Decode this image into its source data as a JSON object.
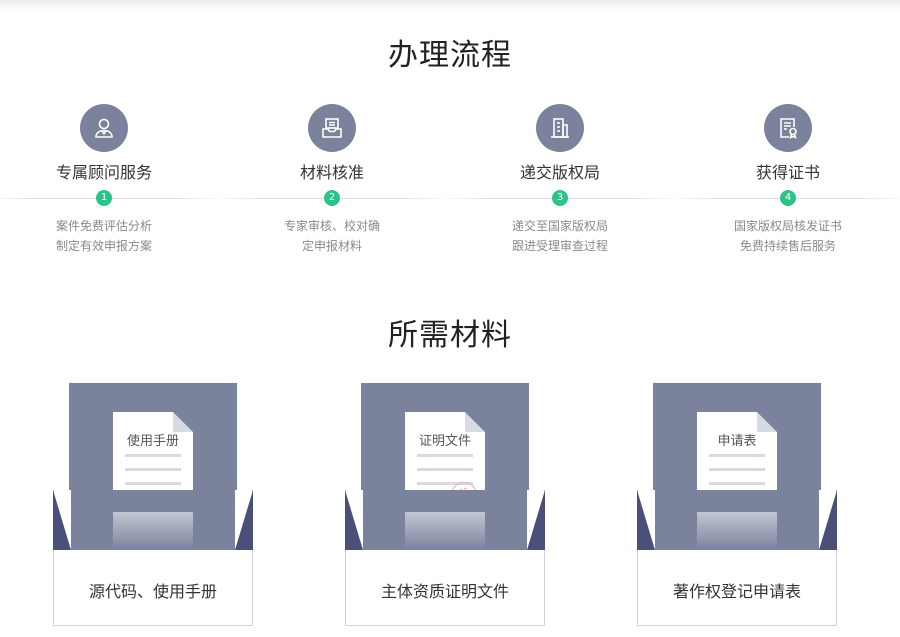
{
  "process": {
    "title": "办理流程",
    "steps": [
      {
        "icon": "consultant-icon",
        "title": "专属顾问服务",
        "num": "1",
        "desc1": "案件免费评估分析",
        "desc2": "制定有效申报方案"
      },
      {
        "icon": "inbox-icon",
        "title": "材料核准",
        "num": "2",
        "desc1": "专家审核、校对确",
        "desc2": "定申报材料"
      },
      {
        "icon": "building-icon",
        "title": "递交版权局",
        "num": "3",
        "desc1": "递交至国家版权局",
        "desc2": "跟进受理审查过程"
      },
      {
        "icon": "certificate-icon",
        "title": "获得证书",
        "num": "4",
        "desc1": "国家版权局核发证书",
        "desc2": "免费持续售后服务"
      }
    ]
  },
  "materials": {
    "title": "所需材料",
    "cards": [
      {
        "doc_title": "使用手册",
        "label": "源代码、使用手册"
      },
      {
        "doc_title": "证明文件",
        "label": "主体资质证明文件"
      },
      {
        "doc_title": "申请表",
        "label": "著作权登记申请表"
      }
    ]
  },
  "colors": {
    "accent": "#2cc38a",
    "icon_bg": "#7a829c",
    "flap": "#4a5077"
  }
}
